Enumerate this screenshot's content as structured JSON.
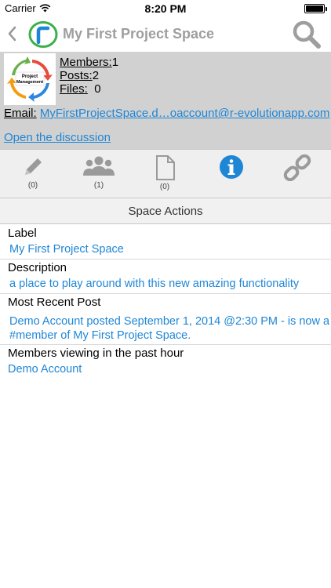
{
  "status_bar": {
    "carrier": "Carrier",
    "time": "8:20 PM"
  },
  "nav": {
    "title": "My First Project Space"
  },
  "space": {
    "thumbnail_text": "Project Management",
    "members_label": "Members:",
    "members_value": "1",
    "posts_label": "Posts:",
    "posts_value": "2",
    "files_label": "Files:",
    "files_value": "0",
    "email_label": "Email:",
    "email_value": "MyFirstProjectSpace.d…oaccount@r-evolutionapp.com",
    "discussion_link": "Open the discussion"
  },
  "toolbar": {
    "items": [
      {
        "icon": "pencil-icon",
        "count": "(0)"
      },
      {
        "icon": "members-icon",
        "count": "(1)"
      },
      {
        "icon": "file-icon",
        "count": "(0)"
      },
      {
        "icon": "info-icon",
        "count": ""
      },
      {
        "icon": "link-icon",
        "count": ""
      }
    ]
  },
  "section": {
    "title": "Space Actions"
  },
  "details": {
    "label_title": "Label",
    "label_value": "My First Project Space",
    "description_title": "Description",
    "description_value": "a place to play around with this new amazing functionality",
    "recent_post_title": "Most Recent Post",
    "recent_post_value": "Demo Account posted September 1, 2014 @2:30 PM - is now a #member of My First Project Space.",
    "members_viewing_title": "Members viewing in the past hour",
    "members_viewing_value": "Demo Account"
  },
  "colors": {
    "accent": "#1f86d6",
    "header_bg": "#d1d1d1",
    "toolbar_bg": "#efefef",
    "logo_green": "#3cb04a"
  }
}
